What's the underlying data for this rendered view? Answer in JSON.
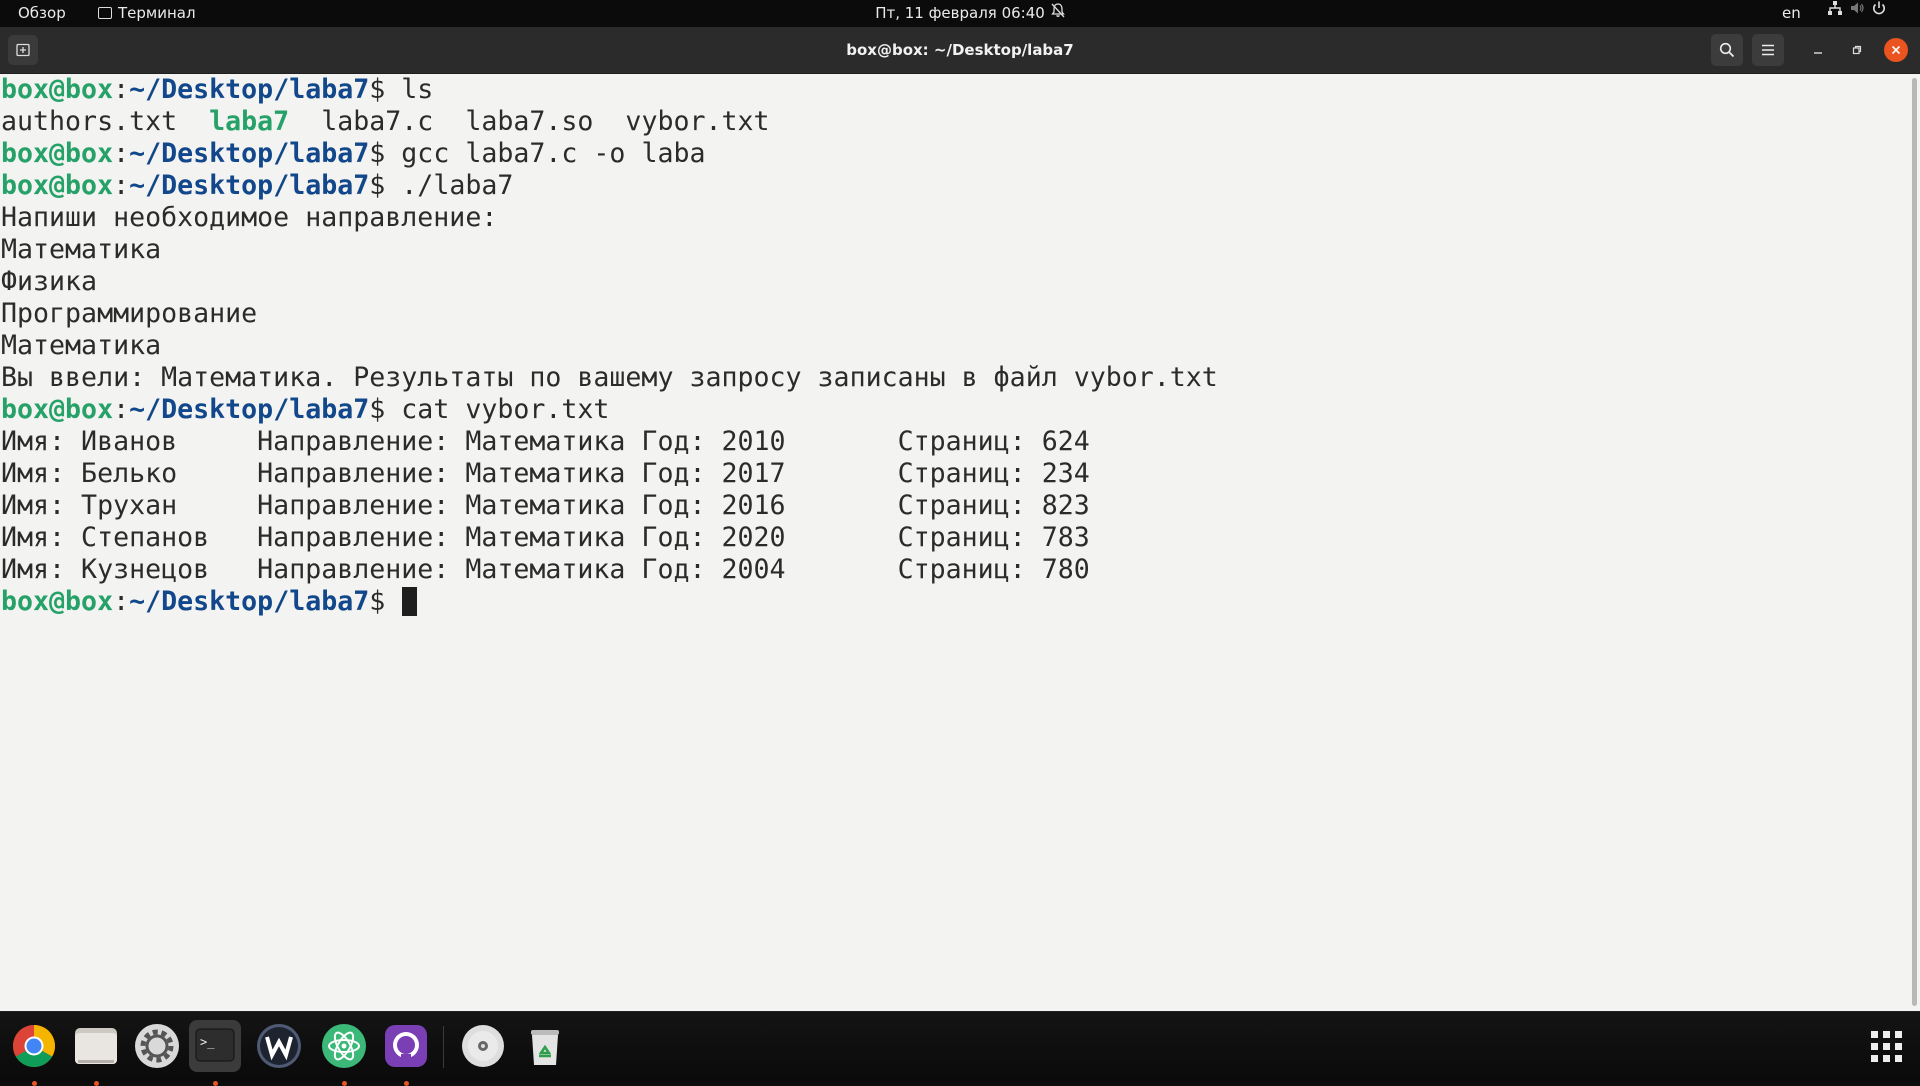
{
  "topbar": {
    "activities": "Обзор",
    "app_menu": "Терминал",
    "clock": "Пт, 11 февраля  06:40",
    "lang": "en"
  },
  "window": {
    "title": "box@box: ~/Desktop/laba7"
  },
  "terminal": {
    "prompt": {
      "user": "box@box",
      "sep": ":",
      "path": "~/Desktop/laba7",
      "dollar": "$ "
    },
    "cmd1": "ls",
    "ls_before": "authors.txt  ",
    "ls_exec": "laba7",
    "ls_after": "  laba7.c  laba7.so  vybor.txt",
    "cmd2": "gcc laba7.c -o laba",
    "cmd3": "./laba7",
    "out_prompt": "Напиши необходимое направление:",
    "opt1": "Математика",
    "opt2": "Физика",
    "opt3": "Программирование",
    "input": "Математика",
    "result": "Вы ввели: Математика. Результаты по вашему запросу записаны в файл vybor.txt",
    "cmd4": "cat vybor.txt",
    "rows": [
      "Имя: Иванов     Направление: Математика Год: 2010       Страниц: 624",
      "Имя: Белько     Направление: Математика Год: 2017       Страниц: 234",
      "Имя: Трухан     Направление: Математика Год: 2016       Страниц: 823",
      "Имя: Степанов   Направление: Математика Год: 2020       Страниц: 783",
      "Имя: Кузнецов   Направление: Математика Год: 2004       Страниц: 780"
    ]
  },
  "dock": {
    "items": [
      "chrome-icon",
      "files-icon",
      "settings-icon",
      "terminal-icon",
      "webstorm-icon",
      "atom-icon",
      "github-desktop-icon",
      "disc-icon",
      "trash-icon"
    ]
  },
  "colors": {
    "prompt_user": "#26a269",
    "prompt_path": "#12488b",
    "terminal_bg": "#f3f3f1",
    "close": "#e95420"
  }
}
